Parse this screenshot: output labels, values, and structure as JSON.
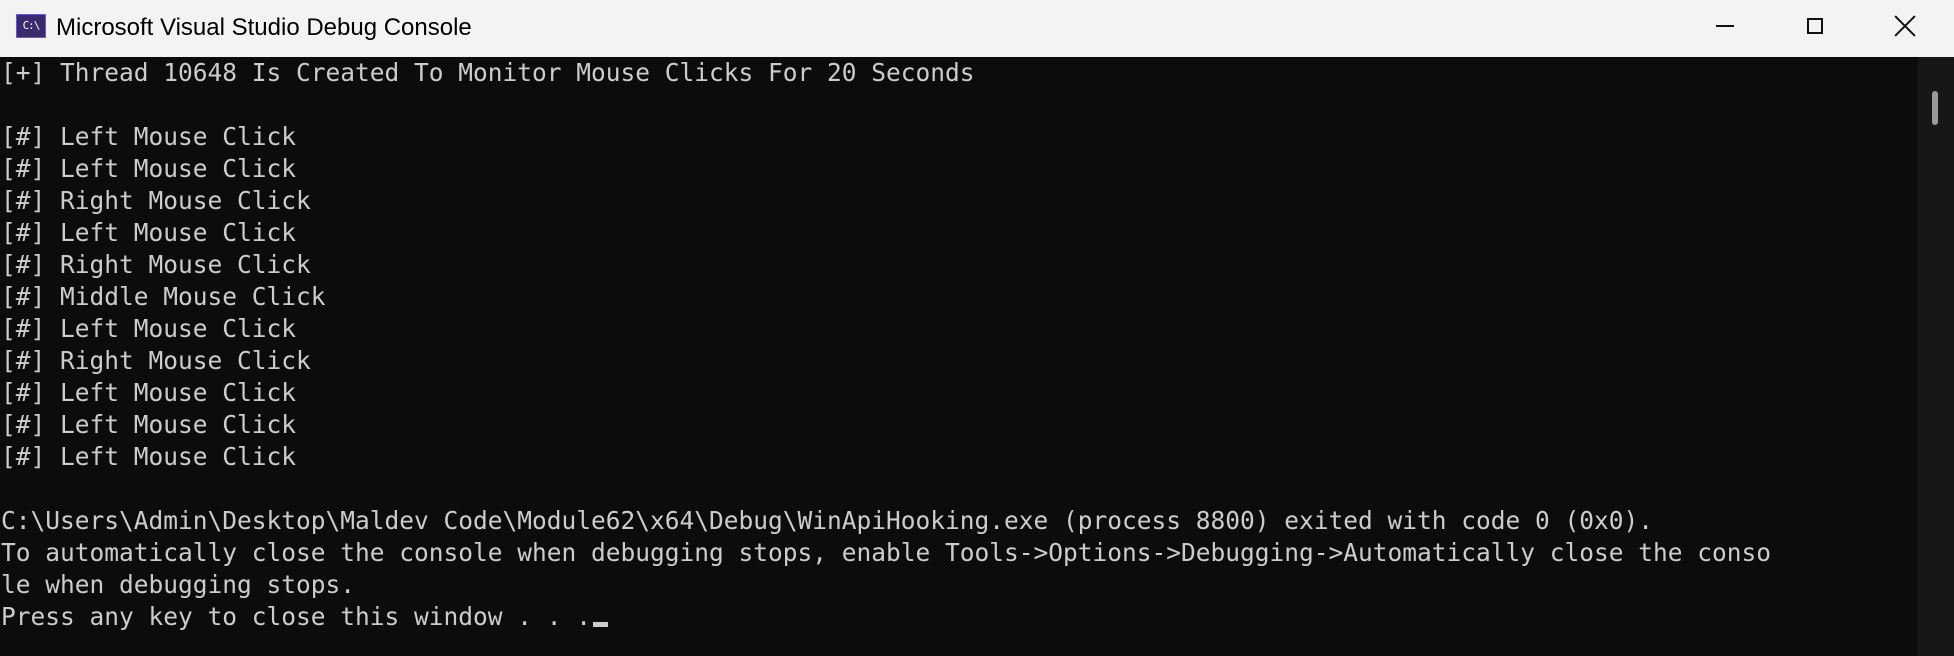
{
  "window": {
    "title": "Microsoft Visual Studio Debug Console",
    "icon_label": "C:\\",
    "icon": "console-app-icon",
    "controls": {
      "minimize": "minimize-icon",
      "maximize": "maximize-icon",
      "close": "close-icon"
    }
  },
  "console": {
    "lines": [
      "[+] Thread 10648 Is Created To Monitor Mouse Clicks For 20 Seconds",
      "",
      "[#] Left Mouse Click",
      "[#] Left Mouse Click",
      "[#] Right Mouse Click",
      "[#] Left Mouse Click",
      "[#] Right Mouse Click",
      "[#] Middle Mouse Click",
      "[#] Left Mouse Click",
      "[#] Right Mouse Click",
      "[#] Left Mouse Click",
      "[#] Left Mouse Click",
      "[#] Left Mouse Click",
      "",
      "C:\\Users\\Admin\\Desktop\\Maldev Code\\Module62\\x64\\Debug\\WinApiHooking.exe (process 8800) exited with code 0 (0x0).",
      "To automatically close the console when debugging stops, enable Tools->Options->Debugging->Automatically close the conso",
      "le when debugging stops.",
      "Press any key to close this window . . ."
    ]
  },
  "colors": {
    "console_background": "#0c0c0c",
    "console_text": "#cccccc",
    "titlebar_background": "#f3f3f3"
  }
}
